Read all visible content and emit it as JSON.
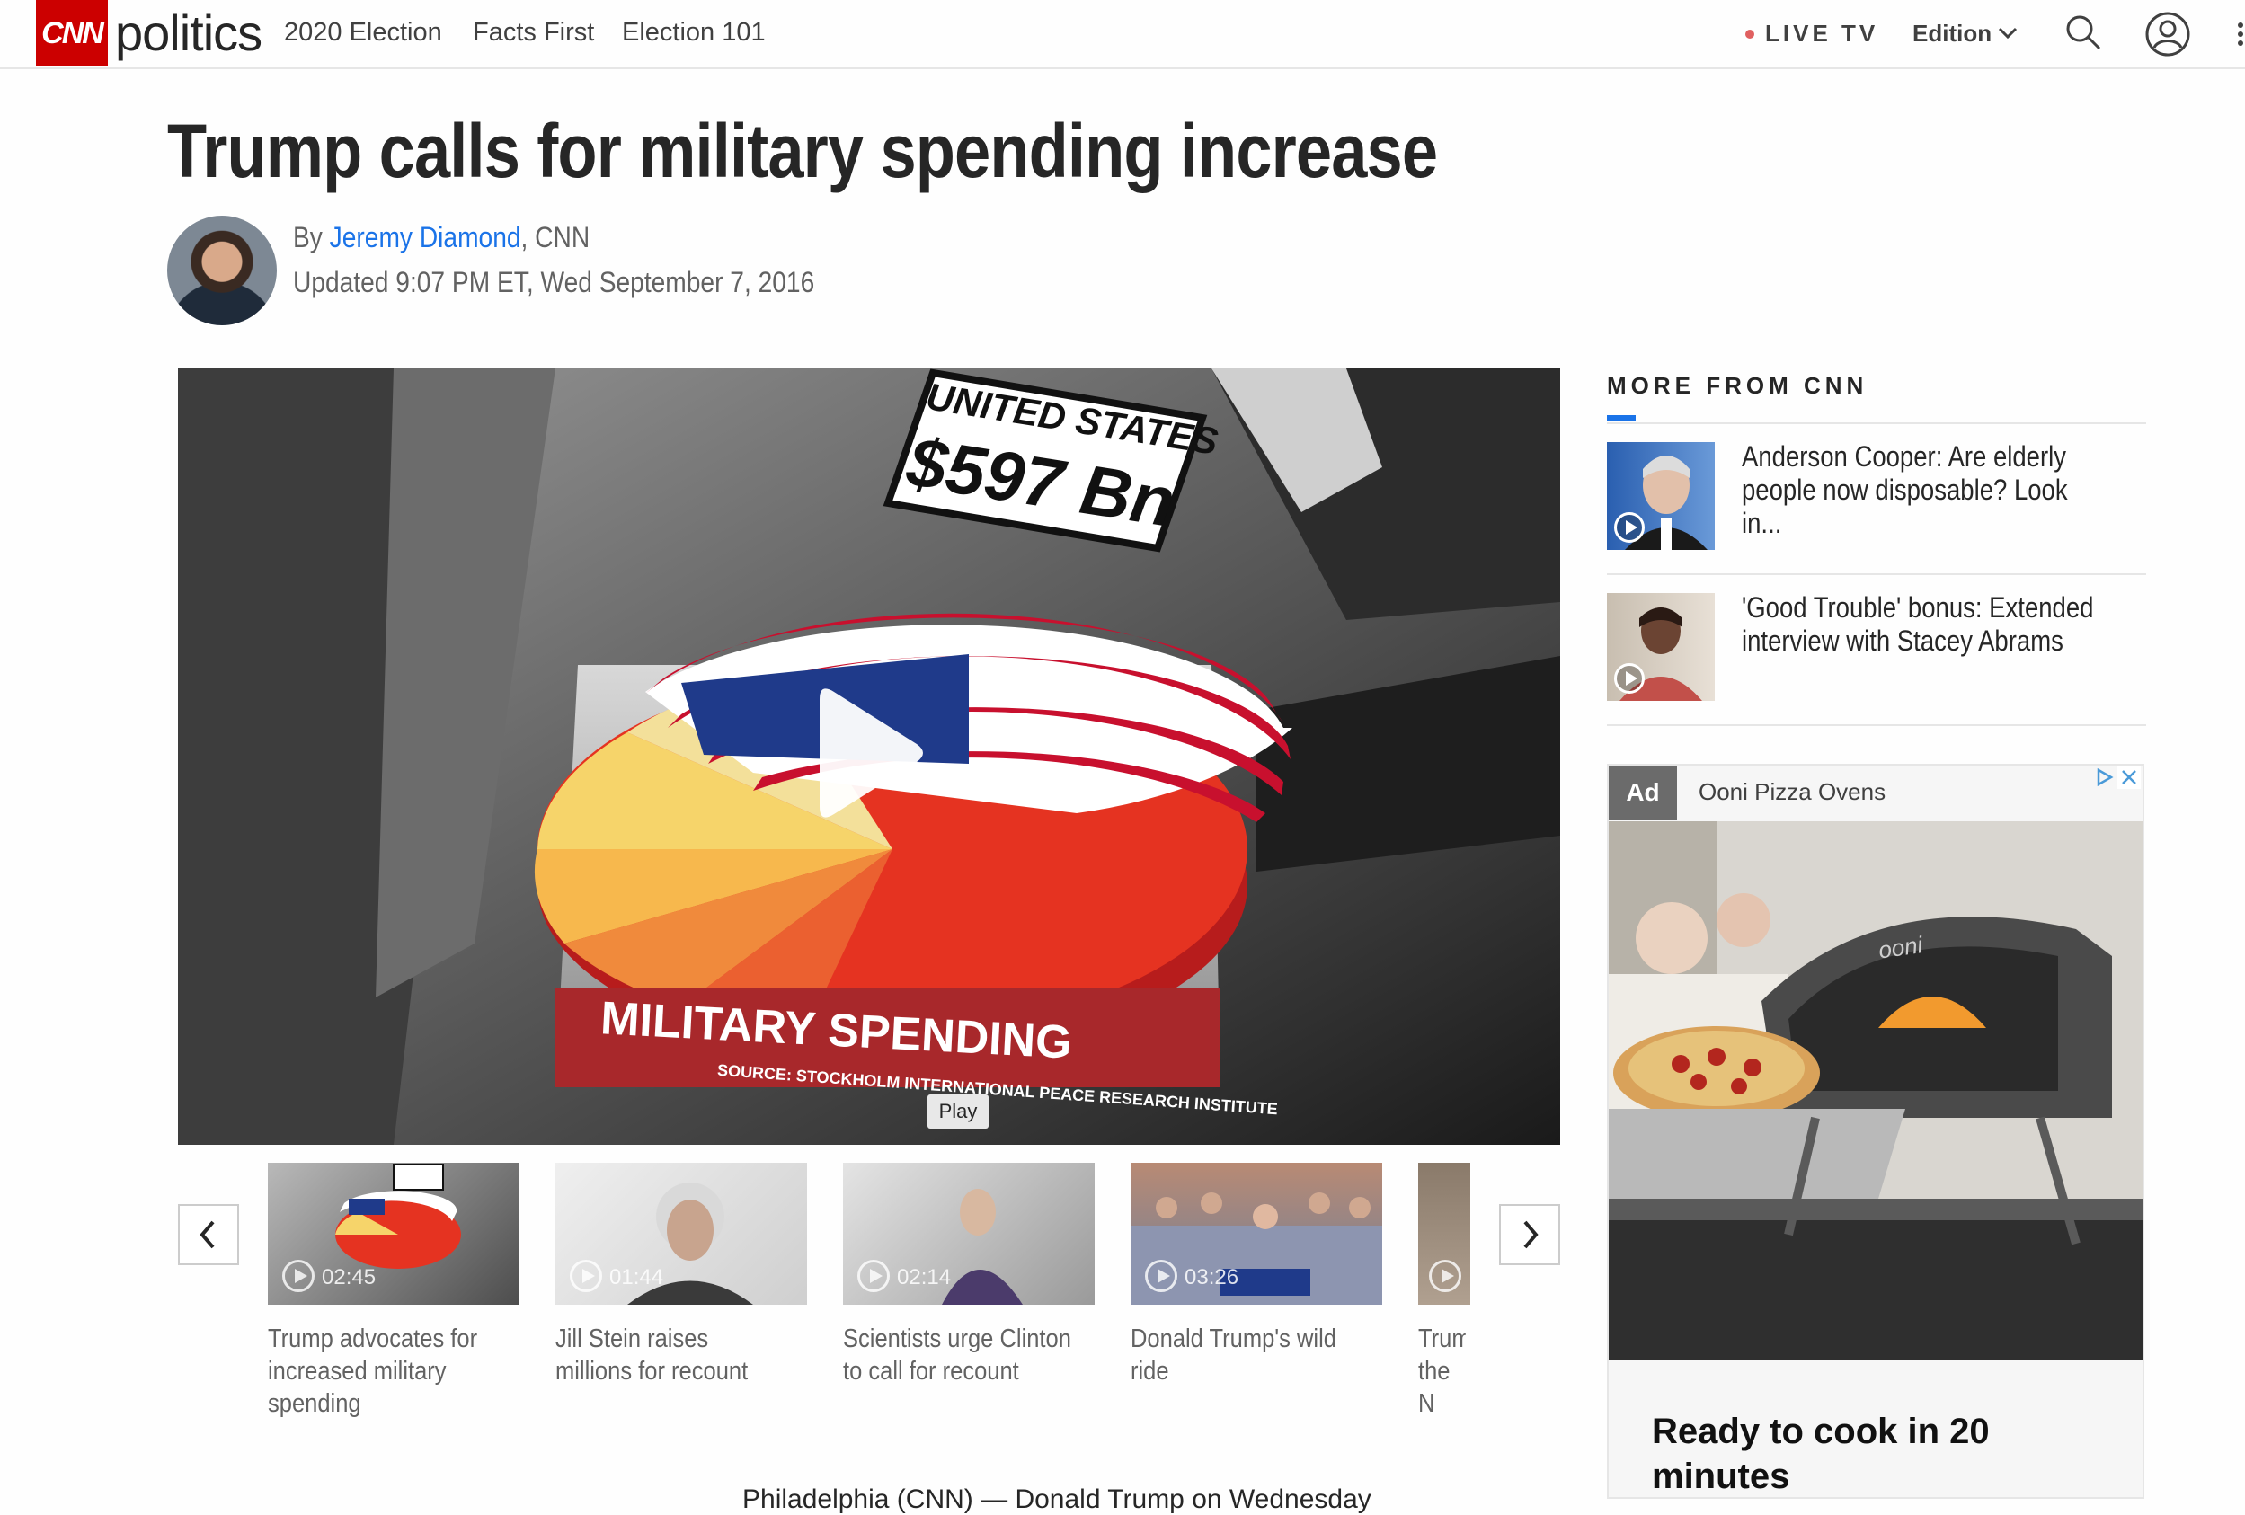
{
  "nav": {
    "logo": "CNN",
    "section": "politics",
    "links": [
      "2020 Election",
      "Facts First",
      "Election 101"
    ],
    "live_tv": "LIVE TV",
    "edition": "Edition"
  },
  "article": {
    "headline": "Trump calls for military spending increase",
    "byline_prefix": "By ",
    "author": "Jeremy Diamond",
    "byline_suffix": ", CNN",
    "updated": "Updated 9:07 PM ET, Wed September 7, 2016",
    "body_start": "Philadelphia (CNN) — Donald Trump on Wednesday"
  },
  "video": {
    "overlay_country": "UNITED STATES",
    "overlay_amount": "$597 Bn",
    "overlay_banner": "MILITARY SPENDING",
    "overlay_source": "SOURCE: STOCKHOLM INTERNATIONAL PEACE RESEARCH INSTITUTE",
    "play_tooltip": "Play"
  },
  "carousel": {
    "items": [
      {
        "duration": "02:45",
        "caption": "Trump advocates for increased military spending"
      },
      {
        "duration": "01:44",
        "caption": "Jill Stein raises millions for recount"
      },
      {
        "duration": "02:14",
        "caption": "Scientists urge Clinton to call for recount"
      },
      {
        "duration": "03:26",
        "caption": "Donald Trump's wild ride"
      },
      {
        "duration": "",
        "caption": "Trum the N"
      }
    ]
  },
  "more_from_cnn": {
    "title": "MORE FROM CNN",
    "items": [
      {
        "text": "Anderson Cooper: Are elderly people now disposable? Look in..."
      },
      {
        "text": "'Good Trouble' bonus: Extended interview with Stacey Abrams"
      }
    ]
  },
  "ad": {
    "label": "Ad",
    "sponsor": "Ooni Pizza Ovens",
    "headline": "Ready to cook in 20 minutes",
    "brand_on_oven": "ooni"
  },
  "colors": {
    "cnn_red": "#cc0000",
    "link_blue": "#1a73e8",
    "text_dark": "#262626",
    "text_gray": "#626262"
  }
}
